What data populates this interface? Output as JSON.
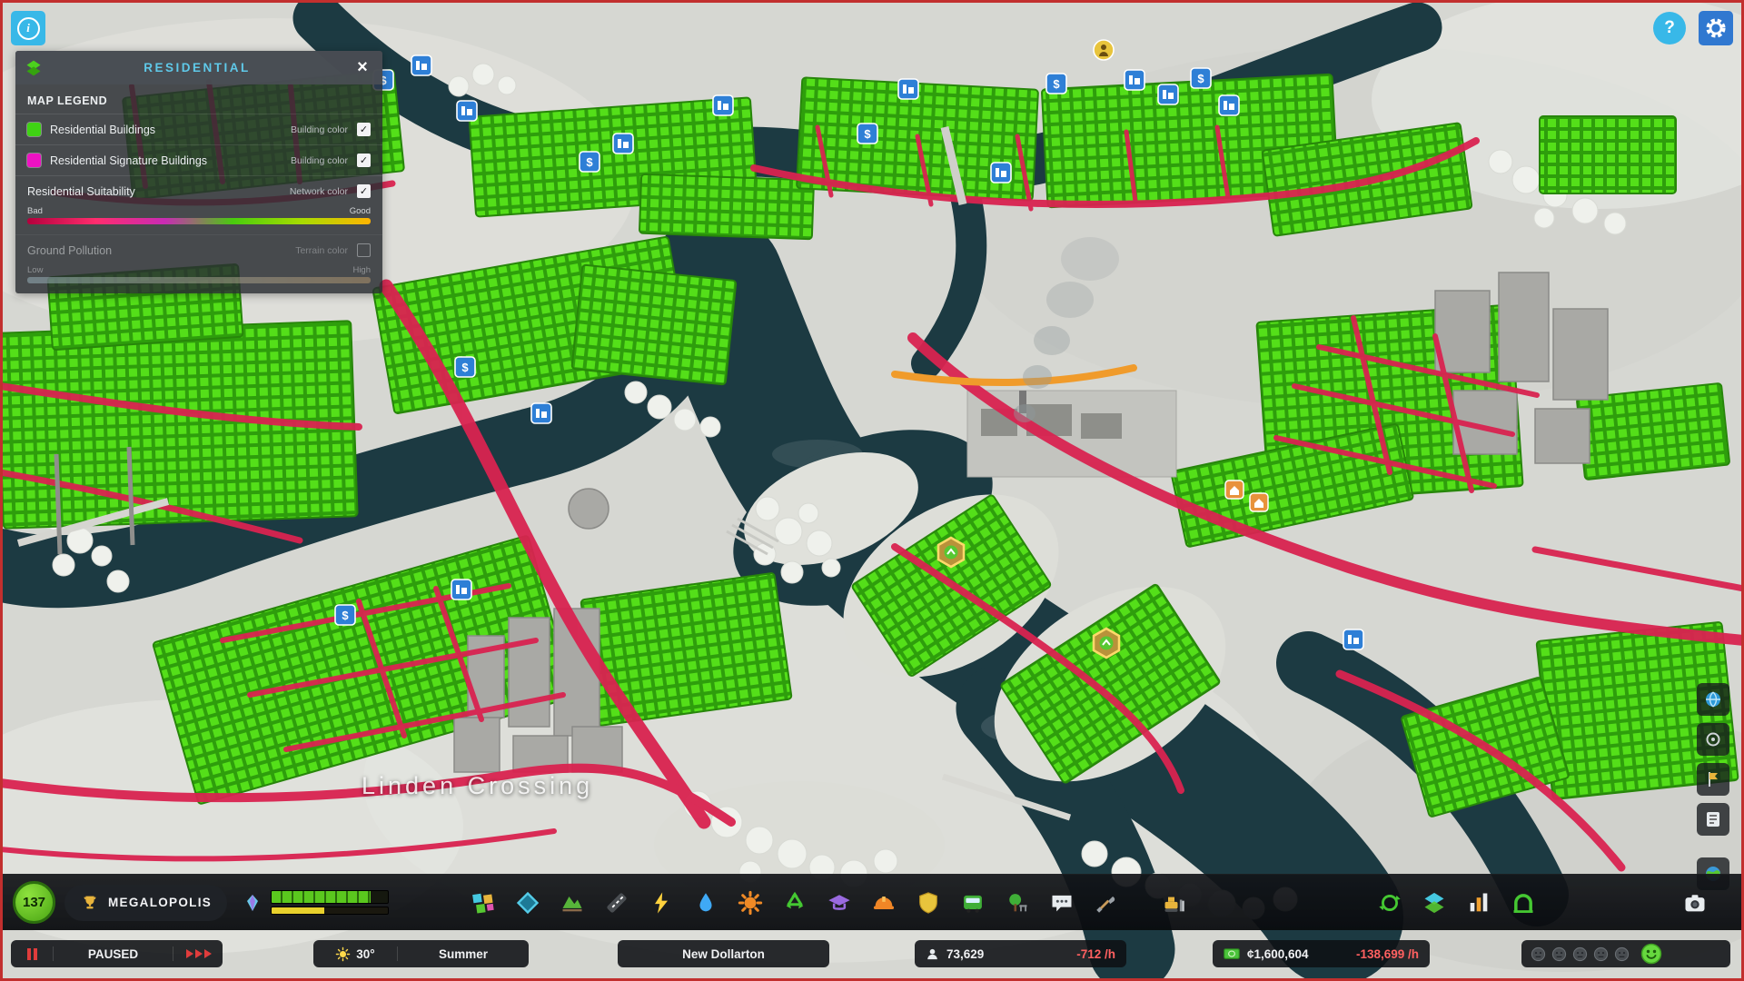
{
  "top": {
    "info_glyph": "i",
    "help_glyph": "?"
  },
  "legend": {
    "title": "RESIDENTIAL",
    "heading": "MAP LEGEND",
    "close_glyph": "×",
    "check_glyph": "✓",
    "rows": [
      {
        "label": "Residential Buildings",
        "type_label": "Building color",
        "swatch_color": "#3fd214",
        "checked": true
      },
      {
        "label": "Residential Signature Buildings",
        "type_label": "Building color",
        "swatch_color": "#ee12c3",
        "checked": true
      },
      {
        "label": "Residential Suitability",
        "type_label": "Network color",
        "checked": true,
        "scale_low": "Bad",
        "scale_high": "Good",
        "gradient": [
          "#b4003c",
          "#ff2d6e",
          "#c92bb4",
          "#49cc0e",
          "#a8dc00",
          "#ffb400"
        ]
      },
      {
        "label": "Ground Pollution",
        "type_label": "Terrain color",
        "checked": false,
        "disabled": true,
        "scale_low": "Low",
        "scale_high": "High",
        "gradient": [
          "#9db8c2",
          "#b99a6e"
        ]
      }
    ]
  },
  "map": {
    "city_label": "Linden Crossing",
    "colors": {
      "water": "#1c3a42",
      "terrain": "#d6d7d2",
      "residential_highlight": "#54df19",
      "signature_highlight": "#ee12c3",
      "bad_suitability_road": "#d92350",
      "warning_road": "#f09b2b"
    }
  },
  "side_buttons": [
    "globe",
    "locate",
    "landmark",
    "journal",
    "photo"
  ],
  "toolbar": {
    "xp_value": "137",
    "milestone_label": "MEGALOPOLIS",
    "progress": {
      "primary_pct": 85,
      "secondary_pct": 45
    },
    "tools": [
      "zoning",
      "areas",
      "terrain",
      "roads",
      "electricity",
      "water-sewage",
      "healthcare",
      "garbage",
      "education",
      "fire-rescue",
      "police",
      "transportation",
      "parks-recreation",
      "communications",
      "landscaping",
      "bulldozer",
      "economy",
      "info-views",
      "statistics",
      "progression",
      "photo-mode"
    ]
  },
  "status": {
    "paused_label": "PAUSED",
    "temperature": "30°",
    "season": "Summer",
    "city_name": "New Dollarton",
    "population": "73,629",
    "population_trend": "-712 /h",
    "treasury": "¢1,600,604",
    "treasury_trend": "-138,699 /h"
  }
}
